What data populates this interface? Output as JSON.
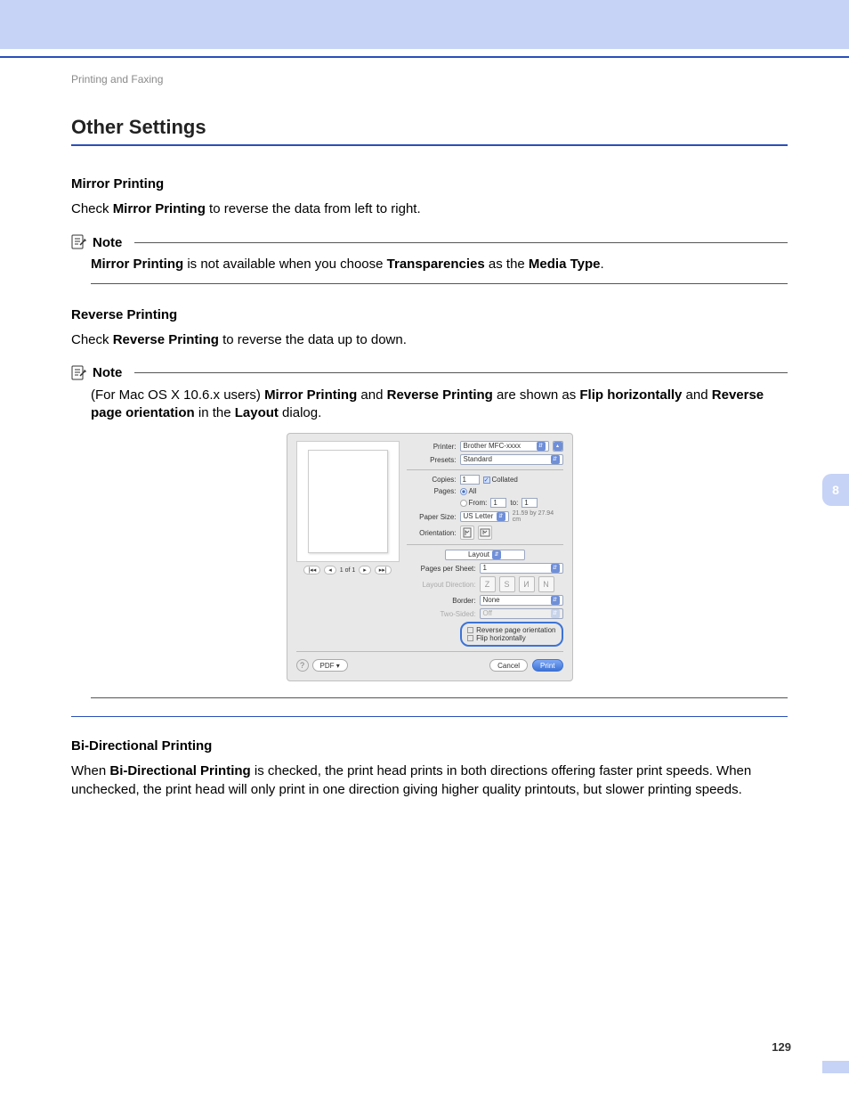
{
  "breadcrumb": "Printing and Faxing",
  "page_number": "129",
  "chapter_tab": "8",
  "section_title": "Other Settings",
  "mirror": {
    "heading": "Mirror Printing",
    "para_pre": "Check ",
    "para_bold": "Mirror Printing",
    "para_post": " to reverse the data from left to right.",
    "note_label": "Note",
    "note_b1": "Mirror Printing",
    "note_t1": " is not available when you choose ",
    "note_b2": "Transparencies",
    "note_t2": " as the ",
    "note_b3": "Media Type",
    "note_t3": "."
  },
  "reverse": {
    "heading": "Reverse Printing",
    "para_pre": "Check ",
    "para_bold": "Reverse Printing",
    "para_post": " to reverse the data up to down.",
    "note_label": "Note",
    "note_t0": "(For Mac OS X 10.6.x users) ",
    "note_b1": "Mirror Printing",
    "note_t1": " and ",
    "note_b2": "Reverse Printing",
    "note_t2": " are shown as ",
    "note_b3": "Flip horizontally",
    "note_t3": " and ",
    "note_b4": "Reverse page orientation",
    "note_t4": " in the ",
    "note_b5": "Layout",
    "note_t5": " dialog."
  },
  "dialog": {
    "printer_label": "Printer:",
    "printer_value": "Brother MFC-xxxx",
    "presets_label": "Presets:",
    "presets_value": "Standard",
    "copies_label": "Copies:",
    "copies_value": "1",
    "collated_label": "Collated",
    "pages_label": "Pages:",
    "pages_all": "All",
    "pages_from": "From:",
    "pages_from_v": "1",
    "pages_to": "to:",
    "pages_to_v": "1",
    "papersize_label": "Paper Size:",
    "papersize_value": "US Letter",
    "papersize_dim": "21.59 by 27.94 cm",
    "orientation_label": "Orientation:",
    "section_value": "Layout",
    "pps_label": "Pages per Sheet:",
    "pps_value": "1",
    "layoutdir_label": "Layout Direction:",
    "border_label": "Border:",
    "border_value": "None",
    "twosided_label": "Two-Sided:",
    "twosided_value": "Off",
    "opt1": "Reverse page orientation",
    "opt2": "Flip horizontally",
    "nav_text": "1 of 1",
    "help": "?",
    "pdf": "PDF ▾",
    "cancel": "Cancel",
    "print": "Print"
  },
  "bidi": {
    "heading": "Bi-Directional Printing",
    "t0": "When ",
    "b1": "Bi-Directional Printing",
    "t1": " is checked, the print head prints in both directions offering faster print speeds. When unchecked, the print head will only print in one direction giving higher quality printouts, but slower printing speeds."
  }
}
